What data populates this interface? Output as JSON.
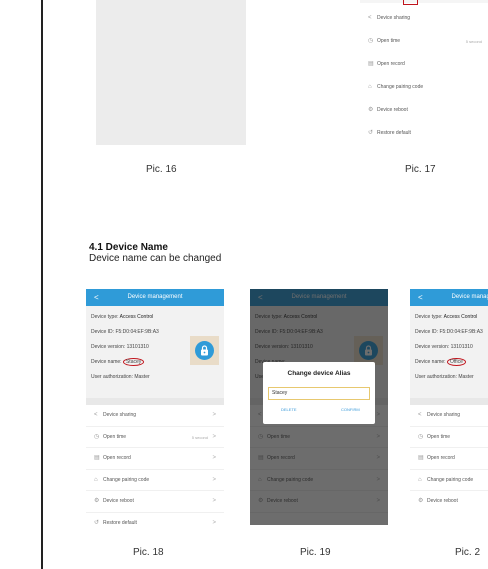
{
  "captions": {
    "pic16": "Pic. 16",
    "pic17": "Pic. 17",
    "pic18": "Pic. 18",
    "pic19": "Pic. 19",
    "pic20": "Pic. 2"
  },
  "section": {
    "title": "4.1 Device Name",
    "text": "Device name can be changed"
  },
  "pic17_menu": [
    {
      "icon": "<",
      "label": "Device sharing",
      "value": ""
    },
    {
      "icon": "◷",
      "label": "Open time",
      "value": "5 second"
    },
    {
      "icon": "▤",
      "label": "Open record",
      "value": ""
    },
    {
      "icon": "⌂",
      "label": "Change pairing code",
      "value": ""
    },
    {
      "icon": "⚙",
      "label": "Device reboot",
      "value": ""
    },
    {
      "icon": "↺",
      "label": "Restore default",
      "value": ""
    }
  ],
  "phone": {
    "header_title": "Device management",
    "back_symbol": "<",
    "device_type_label": "Device type: ",
    "device_type_value": "Access Control",
    "device_id": "Device ID: F5:D0:04:EF:9B:A3",
    "device_version": "Device version: 13101310",
    "device_name_label": "Device name: ",
    "device_name_pic18": "Stacey",
    "device_name_pic20": "Office",
    "user_authorization": "User authorization: Master",
    "chevron": ">",
    "menu": [
      {
        "icon": "<",
        "label": "Device sharing",
        "value": ""
      },
      {
        "icon": "◷",
        "label": "Open time",
        "value": "5 second"
      },
      {
        "icon": "▤",
        "label": "Open record",
        "value": ""
      },
      {
        "icon": "⌂",
        "label": "Change pairing code",
        "value": ""
      },
      {
        "icon": "⚙",
        "label": "Device reboot",
        "value": ""
      },
      {
        "icon": "↺",
        "label": "Restore default",
        "value": ""
      }
    ]
  },
  "dialog": {
    "title": "Change device Alias",
    "input_value": "Stacey",
    "delete_label": "DELETE",
    "confirm_label": "CONFIRM"
  }
}
